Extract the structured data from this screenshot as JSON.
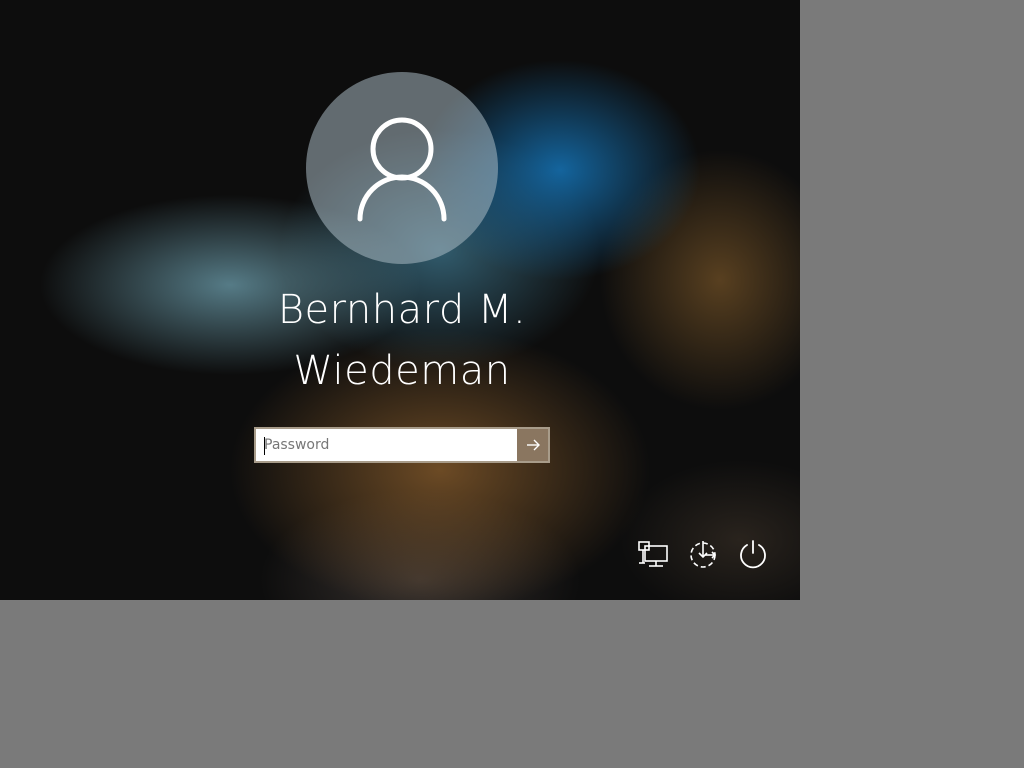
{
  "user": {
    "name": "Bernhard M.\nWiedeman",
    "avatar_icon": "user-avatar-icon"
  },
  "login": {
    "password_placeholder": "Password",
    "password_value": "",
    "submit_icon": "arrow-right-icon"
  },
  "bottom_bar": {
    "items": [
      {
        "icon": "network-icon"
      },
      {
        "icon": "ease-of-access-icon"
      },
      {
        "icon": "power-icon"
      }
    ]
  },
  "colors": {
    "background_gray": "#7a7a7a",
    "submit_button": "#8a7660",
    "input_border": "#a89c8a",
    "text": "#ffffff"
  }
}
